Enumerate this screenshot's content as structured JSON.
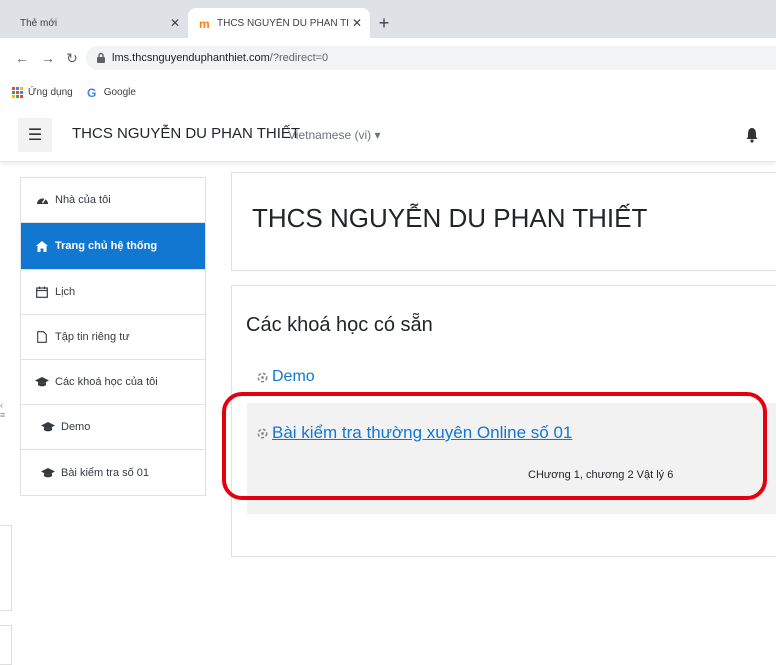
{
  "browser": {
    "tabs": [
      {
        "title": "Thẻ mới",
        "active": false
      },
      {
        "title": "THCS NGUYỄN DU PHAN THIẾT",
        "active": true
      }
    ],
    "url_host": "lms.thcsnguyenduphanthiet.com",
    "url_path": "/?redirect=0",
    "bookmarks": [
      {
        "label": "Ứng dụng",
        "icon": "apps-grid-icon"
      },
      {
        "label": "Google",
        "icon": "google-icon"
      }
    ]
  },
  "navbar": {
    "site_name": "THCS NGUYỄN DU PHAN THIẾT",
    "language": "Vietnamese (vi) ▾"
  },
  "sidebar": {
    "items": [
      {
        "label": "Nhà của tôi",
        "icon": "tachometer-icon",
        "active": false
      },
      {
        "label": "Trang chủ hệ thống",
        "icon": "home-icon",
        "active": true
      },
      {
        "label": "Lịch",
        "icon": "calendar-icon",
        "active": false
      },
      {
        "label": "Tập tin riêng tư",
        "icon": "file-icon",
        "active": false
      },
      {
        "label": "Các khoá học của tôi",
        "icon": "graduation-cap-icon",
        "active": false
      },
      {
        "label": "Demo",
        "icon": "graduation-cap-icon",
        "active": false
      },
      {
        "label": "Bài kiểm tra số 01",
        "icon": "graduation-cap-icon",
        "active": false
      }
    ]
  },
  "main": {
    "page_title": "THCS NGUYỄN DU PHAN THIẾT",
    "available_courses_title": "Các khoá học có sẵn",
    "courses": [
      {
        "name": "Demo"
      },
      {
        "name": "Bài kiểm tra thường xuyên Online số 01",
        "summary": "CHương 1, chương 2  Vật lý 6"
      }
    ]
  },
  "colors": {
    "accent": "#1177d1",
    "highlight": "#e3000f"
  }
}
